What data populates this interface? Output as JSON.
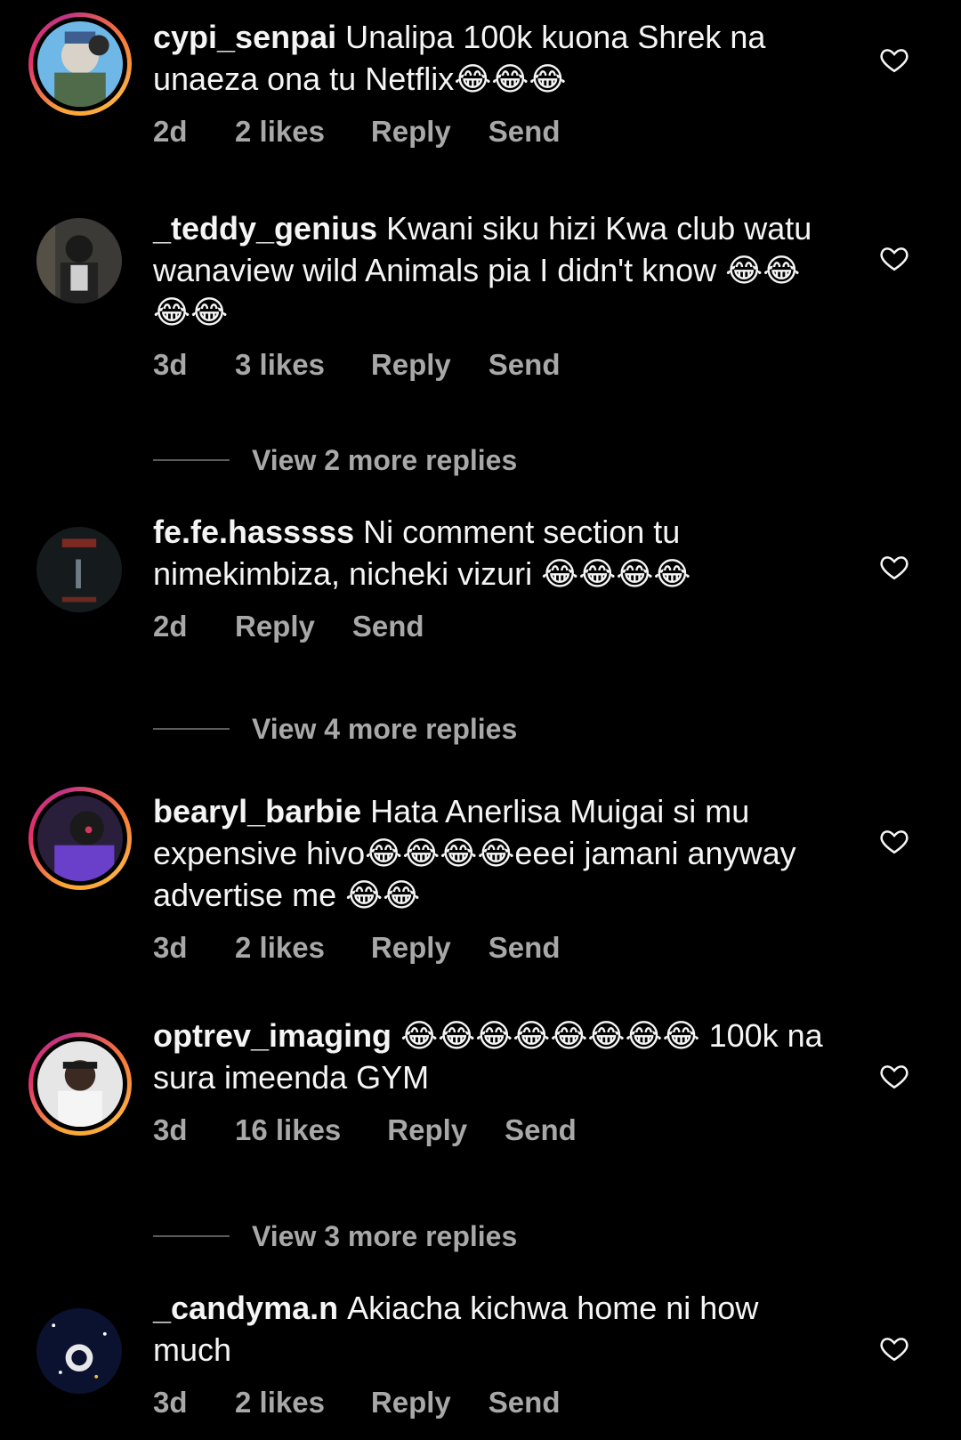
{
  "colors": {
    "background": "#000000",
    "text": "#f5f5f5",
    "meta": "#a8a8a8",
    "divider": "#5c5c5c",
    "story_ring_start": "#f9a634",
    "story_ring_end": "#c13584"
  },
  "comments": [
    {
      "username": "cypi_senpai",
      "text": "Unalipa 100k kuona Shrek na unaeza ona tu Netflix😂😂😂",
      "time": "2d",
      "likes": "2 likes",
      "reply": "Reply",
      "send": "Send",
      "story_ring": true,
      "icon": "heart-outline-icon"
    },
    {
      "username": "_teddy_genius",
      "text": "Kwani siku hizi Kwa club watu wanaview wild Animals pia I didn't know 😂😂😂😂",
      "time": "3d",
      "likes": "3 likes",
      "reply": "Reply",
      "send": "Send",
      "story_ring": false,
      "icon": "heart-outline-icon"
    },
    {
      "username": "fe.fe.hasssss",
      "text": "Ni comment section tu nimekimbiza, nicheki vizuri 😂😂😂😂",
      "time": "2d",
      "likes": "",
      "reply": "Reply",
      "send": "Send",
      "story_ring": false,
      "icon": "heart-outline-icon"
    },
    {
      "username": "bearyl_barbie",
      "text": "Hata Anerlisa Muigai si mu expensive hivo😂😂😂😂eeei jamani anyway advertise me 😂😂",
      "time": "3d",
      "likes": "2 likes",
      "reply": "Reply",
      "send": "Send",
      "story_ring": true,
      "icon": "heart-outline-icon"
    },
    {
      "username": "optrev_imaging",
      "text": "😂😂😂😂😂😂😂😂 100k na sura imeenda GYM",
      "time": "3d",
      "likes": "16 likes",
      "reply": "Reply",
      "send": "Send",
      "story_ring": true,
      "icon": "heart-outline-icon"
    },
    {
      "username": "_candyma.n",
      "text": "Akiacha kichwa home ni how much",
      "time": "3d",
      "likes": "2 likes",
      "reply": "Reply",
      "send": "Send",
      "story_ring": false,
      "icon": "heart-outline-icon"
    }
  ],
  "view_more": [
    {
      "label": "View 2 more replies"
    },
    {
      "label": "View 4 more replies"
    },
    {
      "label": "View 3 more replies"
    }
  ]
}
